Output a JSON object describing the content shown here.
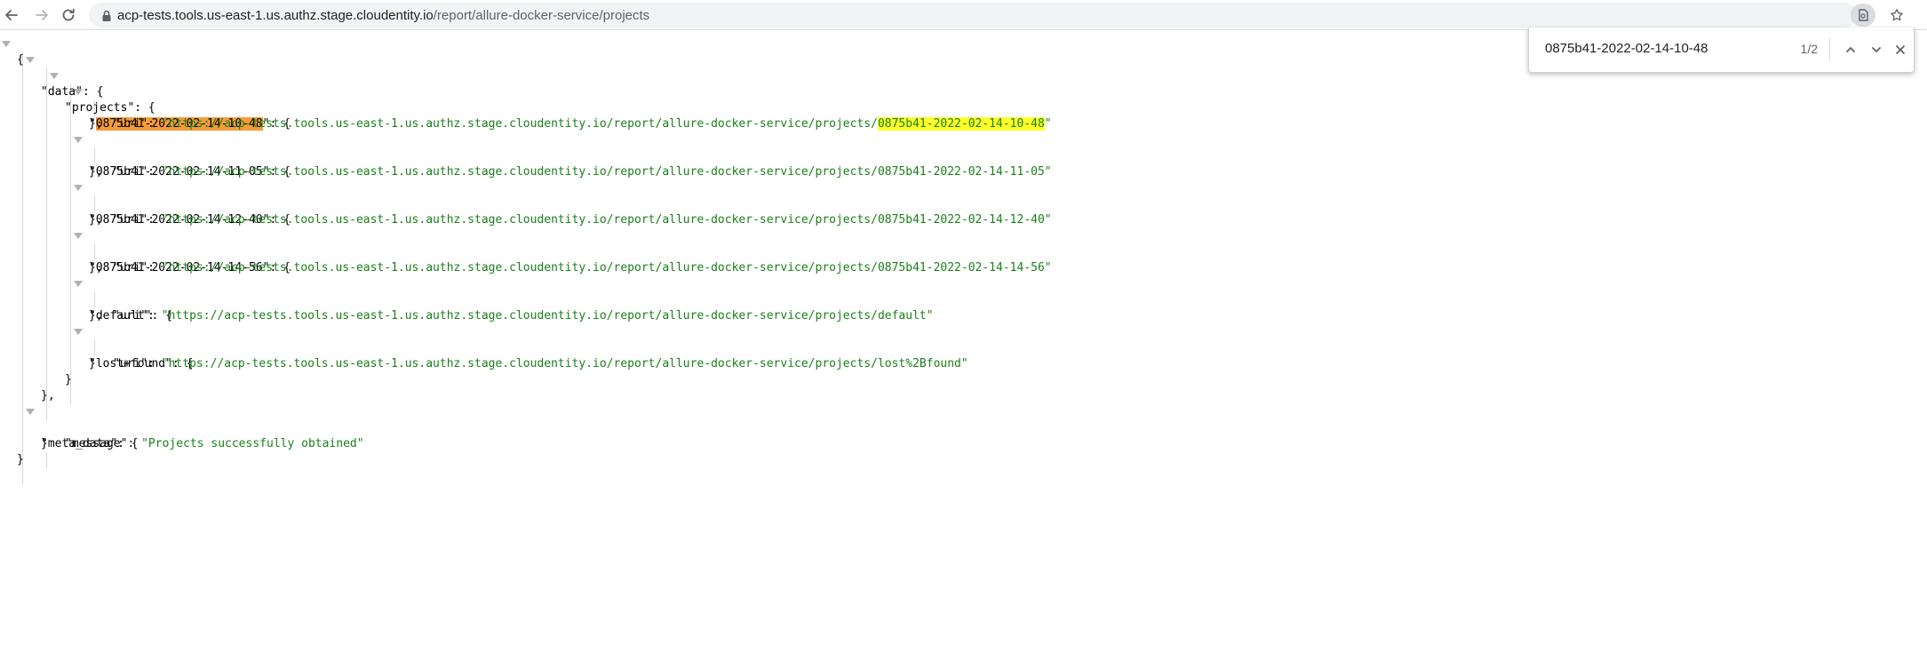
{
  "browser": {
    "url_host": "acp-tests.tools.us-east-1.us.authz.stage.cloudentity.io",
    "url_path": "/report/allure-docker-service/projects"
  },
  "find": {
    "query": "0875b41-2022-02-14-10-48",
    "count": "1/2"
  },
  "json": {
    "open_brace": "{",
    "close_brace": "}",
    "data_key": "\"data\"",
    "projects_key": "\"projects\"",
    "projects": [
      {
        "key": "0875b41-2022-02-14-10-48",
        "uri_key": "\"uri\"",
        "uri_prefix": "https://acp-tests.tools.us-east-1.us.authz.stage.cloudentity.io/report/allure-docker-service/projects/",
        "uri_suffix": "0875b41-2022-02-14-10-48"
      },
      {
        "key": "0875b41-2022-02-14-11-05",
        "uri_key": "\"uri\"",
        "uri_prefix": "https://acp-tests.tools.us-east-1.us.authz.stage.cloudentity.io/report/allure-docker-service/projects/",
        "uri_suffix": "0875b41-2022-02-14-11-05"
      },
      {
        "key": "0875b41-2022-02-14-12-40",
        "uri_key": "\"uri\"",
        "uri_prefix": "https://acp-tests.tools.us-east-1.us.authz.stage.cloudentity.io/report/allure-docker-service/projects/",
        "uri_suffix": "0875b41-2022-02-14-12-40"
      },
      {
        "key": "0875b41-2022-02-14-14-56",
        "uri_key": "\"uri\"",
        "uri_prefix": "https://acp-tests.tools.us-east-1.us.authz.stage.cloudentity.io/report/allure-docker-service/projects/",
        "uri_suffix": "0875b41-2022-02-14-14-56"
      },
      {
        "key": "default",
        "uri_key": "\"uri\"",
        "uri_prefix": "https://acp-tests.tools.us-east-1.us.authz.stage.cloudentity.io/report/allure-docker-service/projects/",
        "uri_suffix": "default"
      },
      {
        "key": "lost+found",
        "uri_key": "\"uri\"",
        "uri_prefix": "https://acp-tests.tools.us-east-1.us.authz.stage.cloudentity.io/report/allure-docker-service/projects/",
        "uri_suffix": "lost%2Bfound"
      }
    ],
    "meta_data_key": "\"meta_data\"",
    "message_key": "\"message\"",
    "message_value": "\"Projects successfully obtained\""
  }
}
